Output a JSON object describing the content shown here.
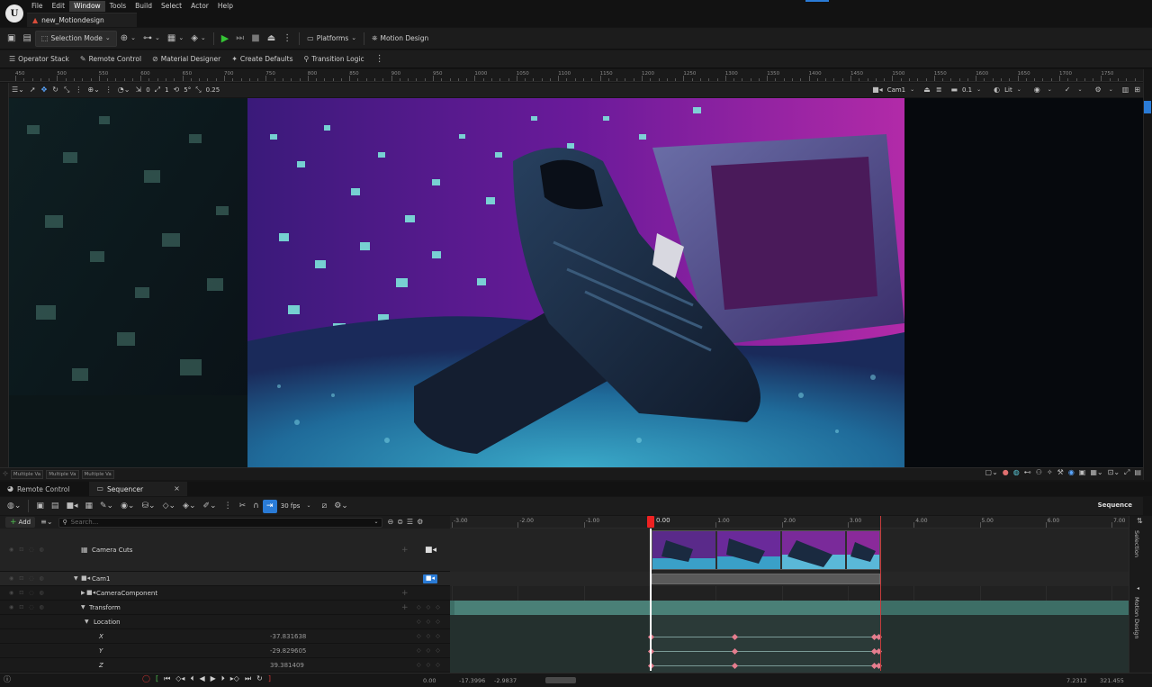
{
  "menubar": {
    "logo": "U",
    "items": [
      "File",
      "Edit",
      "Window",
      "Tools",
      "Build",
      "Select",
      "Actor",
      "Help"
    ],
    "active_item": "Window",
    "project_tab": "new_Motiondesign"
  },
  "toolbar": {
    "selection_mode": "Selection Mode",
    "platforms": "Platforms",
    "motion_design": "Motion Design"
  },
  "toolbar2": {
    "items": [
      "Operator Stack",
      "Remote Control",
      "Material Designer",
      "Create Defaults",
      "Transition Logic"
    ]
  },
  "ruler": {
    "labels": [
      "450",
      "500",
      "550",
      "600",
      "650",
      "700",
      "750",
      "800",
      "850",
      "900",
      "950",
      "1000",
      "1050",
      "1100",
      "1150",
      "1200",
      "1250",
      "1300",
      "1350",
      "1400",
      "1450",
      "1500",
      "1550",
      "1600",
      "1650",
      "1700",
      "1750"
    ]
  },
  "viewport_toolbar": {
    "snap_values": [
      "0",
      "1",
      "5°",
      "0.25"
    ],
    "camera": "Cam1",
    "speed": "0.1",
    "view_mode": "Lit"
  },
  "viewport_bottom": {
    "chips": [
      "Multiple Va",
      "Multiple Va",
      "Multiple Va"
    ]
  },
  "panel_tabs": {
    "remote_control": "Remote Control",
    "sequencer": "Sequencer"
  },
  "sequencer": {
    "fps": "30 fps",
    "title": "Sequence",
    "add_label": "Add",
    "search_placeholder": "Search...",
    "playhead_time": "0.00",
    "time_labels": [
      "-3.00",
      "-2.00",
      "-1.00",
      "0.00",
      "1.00",
      "2.00",
      "3.00",
      "4.00",
      "5.00",
      "6.00",
      "7.00"
    ],
    "tracks": [
      {
        "label": "Camera Cuts",
        "value": ""
      },
      {
        "label": "Cam1",
        "value": ""
      },
      {
        "label": "CameraComponent",
        "value": ""
      },
      {
        "label": "Transform",
        "value": ""
      },
      {
        "label": "Location",
        "value": ""
      },
      {
        "label": "X",
        "value": "-37.831638"
      },
      {
        "label": "Y",
        "value": "-29.829605"
      },
      {
        "label": "Z",
        "value": "39.381409"
      }
    ],
    "side_tabs": [
      "Selection",
      "Motion Design"
    ],
    "bottom": {
      "current_time": "0.00",
      "view_start": "-17.3996",
      "view_in": "-2.9837",
      "view_out": "7.2312",
      "view_end": "321.455"
    }
  },
  "colors": {
    "accent_blue": "#2a7bd6",
    "play_green": "#35c435",
    "playhead_red": "#e22222",
    "keyframe_pink": "#e57d8e"
  }
}
